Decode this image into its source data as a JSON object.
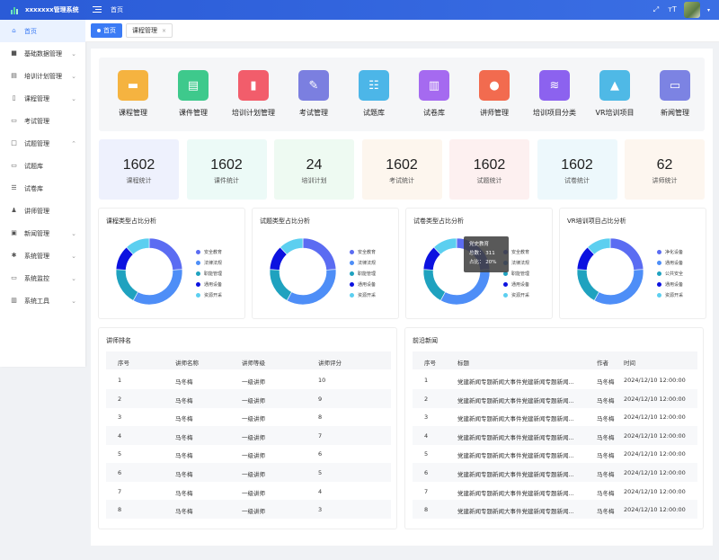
{
  "header": {
    "app_title": "xxxxxxx管理系统",
    "home_link": "首页"
  },
  "sidebar": {
    "items": [
      {
        "label": "首页",
        "icon": "home-icon",
        "glyph": "⌂",
        "active": true,
        "arrow": ""
      },
      {
        "label": "基础数据管理",
        "icon": "database-icon",
        "glyph": "■",
        "active": false,
        "arrow": "⌄"
      },
      {
        "label": "培训计划管理",
        "icon": "plan-icon",
        "glyph": "▤",
        "active": false,
        "arrow": "⌄"
      },
      {
        "label": "课程管理",
        "icon": "book-icon",
        "glyph": "▯",
        "active": false,
        "arrow": "⌄"
      },
      {
        "label": "考试管理",
        "icon": "exam-icon",
        "glyph": "▭",
        "active": false,
        "arrow": ""
      },
      {
        "label": "试题管理",
        "icon": "question-icon",
        "glyph": "□",
        "active": false,
        "arrow": "⌃"
      },
      {
        "label": "试题库",
        "icon": "bank-icon",
        "glyph": "▭",
        "active": false,
        "arrow": ""
      },
      {
        "label": "试卷库",
        "icon": "list-icon",
        "glyph": "☰",
        "active": false,
        "arrow": ""
      },
      {
        "label": "讲师管理",
        "icon": "teacher-icon",
        "glyph": "♟",
        "active": false,
        "arrow": ""
      },
      {
        "label": "新闻管理",
        "icon": "news-icon",
        "glyph": "▣",
        "active": false,
        "arrow": "⌄"
      },
      {
        "label": "系统管理",
        "icon": "gear-icon",
        "glyph": "✱",
        "active": false,
        "arrow": "⌄"
      },
      {
        "label": "系统监控",
        "icon": "monitor-icon",
        "glyph": "▭",
        "active": false,
        "arrow": "⌄"
      },
      {
        "label": "系统工具",
        "icon": "tools-icon",
        "glyph": "▥",
        "active": false,
        "arrow": "⌄"
      }
    ]
  },
  "tabs": [
    {
      "label": "首页",
      "active": true
    },
    {
      "label": "课程管理",
      "active": false
    }
  ],
  "modules": [
    {
      "label": "课程管理",
      "color": "#f5b340",
      "icon": "course-icon",
      "glyph": "▬"
    },
    {
      "label": "课件管理",
      "color": "#3ec98c",
      "icon": "courseware-icon",
      "glyph": "▤"
    },
    {
      "label": "培训计划管理",
      "color": "#f25d6b",
      "icon": "training-plan-icon",
      "glyph": "▮"
    },
    {
      "label": "考试管理",
      "color": "#7b7fe0",
      "icon": "exam-icon",
      "glyph": "✎"
    },
    {
      "label": "试题库",
      "color": "#4cb6e8",
      "icon": "question-bank-icon",
      "glyph": "☷"
    },
    {
      "label": "试卷库",
      "color": "#a56af0",
      "icon": "paper-bank-icon",
      "glyph": "▥"
    },
    {
      "label": "讲师管理",
      "color": "#f26b4f",
      "icon": "lecturer-icon",
      "glyph": "●"
    },
    {
      "label": "培训项目分类",
      "color": "#8c62ef",
      "icon": "layers-icon",
      "glyph": "≋"
    },
    {
      "label": "VR培训项目",
      "color": "#4fb9e6",
      "icon": "vr-icon",
      "glyph": "▲"
    },
    {
      "label": "新闻管理",
      "color": "#7c83e3",
      "icon": "message-icon",
      "glyph": "▭"
    }
  ],
  "stats": [
    {
      "value": "1602",
      "label": "课程统计",
      "bg": "#eef1fd"
    },
    {
      "value": "1602",
      "label": "课件统计",
      "bg": "#ecfaf7"
    },
    {
      "value": "24",
      "label": "培训计划",
      "bg": "#eefaf2"
    },
    {
      "value": "1602",
      "label": "考试统计",
      "bg": "#fdf6ee"
    },
    {
      "value": "1602",
      "label": "试题统计",
      "bg": "#fdf0f0"
    },
    {
      "value": "1602",
      "label": "试卷统计",
      "bg": "#edf8fc"
    },
    {
      "value": "62",
      "label": "讲师统计",
      "bg": "#fdf6ef"
    }
  ],
  "chart_data": [
    {
      "type": "pie",
      "title": "课程类型占比分析",
      "categories": [
        "安全教育",
        "法律法规",
        "职能管理",
        "通用设备",
        "资源开采"
      ],
      "values": [
        24,
        34,
        18,
        12,
        12
      ],
      "colors": [
        "#5b6cf2",
        "#4e8ef7",
        "#1fa2bf",
        "#0c12e0",
        "#5ccff0"
      ]
    },
    {
      "type": "pie",
      "title": "试题类型占比分析",
      "categories": [
        "安全教育",
        "法律法规",
        "职能管理",
        "通用设备",
        "资源开采"
      ],
      "values": [
        24,
        34,
        18,
        12,
        12
      ],
      "colors": [
        "#5b6cf2",
        "#4e8ef7",
        "#1fa2bf",
        "#0c12e0",
        "#5ccff0"
      ]
    },
    {
      "type": "pie",
      "title": "试卷类型占比分析",
      "categories": [
        "安全教育",
        "法律法规",
        "职能管理",
        "通用设备",
        "资源开采"
      ],
      "values": [
        24,
        34,
        18,
        12,
        12
      ],
      "colors": [
        "#5b6cf2",
        "#4e8ef7",
        "#1fa2bf",
        "#0c12e0",
        "#5ccff0"
      ],
      "tooltip": {
        "name": "党史教育",
        "count_label": "总数：",
        "count": "311",
        "ratio_label": "占比：",
        "ratio": "20%"
      }
    },
    {
      "type": "pie",
      "title": "VR培训项目占比分析",
      "categories": [
        "净化设备",
        "通用设备",
        "公共安全",
        "通用设备",
        "资源开采"
      ],
      "values": [
        24,
        34,
        18,
        12,
        12
      ],
      "colors": [
        "#5b6cf2",
        "#4e8ef7",
        "#1fa2bf",
        "#0c12e0",
        "#5ccff0"
      ]
    }
  ],
  "lecturer_table": {
    "title": "讲师排名",
    "columns": [
      "序号",
      "讲师名称",
      "讲师等级",
      "讲师评分"
    ],
    "rows": [
      [
        "1",
        "马冬梅",
        "一级讲师",
        "10"
      ],
      [
        "2",
        "马冬梅",
        "一级讲师",
        "9"
      ],
      [
        "3",
        "马冬梅",
        "一级讲师",
        "8"
      ],
      [
        "4",
        "马冬梅",
        "一级讲师",
        "7"
      ],
      [
        "5",
        "马冬梅",
        "一级讲师",
        "6"
      ],
      [
        "6",
        "马冬梅",
        "一级讲师",
        "5"
      ],
      [
        "7",
        "马冬梅",
        "一级讲师",
        "4"
      ],
      [
        "8",
        "马冬梅",
        "一级讲师",
        "3"
      ]
    ]
  },
  "news_table": {
    "title": "前沿新闻",
    "columns": [
      "序号",
      "标题",
      "作者",
      "时间"
    ],
    "rows": [
      [
        "1",
        "党建新闻专题新闻大事件党建新闻专题新闻...",
        "马冬梅",
        "2024/12/10 12:00:00"
      ],
      [
        "2",
        "党建新闻专题新闻大事件党建新闻专题新闻...",
        "马冬梅",
        "2024/12/10 12:00:00"
      ],
      [
        "3",
        "党建新闻专题新闻大事件党建新闻专题新闻...",
        "马冬梅",
        "2024/12/10 12:00:00"
      ],
      [
        "4",
        "党建新闻专题新闻大事件党建新闻专题新闻...",
        "马冬梅",
        "2024/12/10 12:00:00"
      ],
      [
        "5",
        "党建新闻专题新闻大事件党建新闻专题新闻...",
        "马冬梅",
        "2024/12/10 12:00:00"
      ],
      [
        "6",
        "党建新闻专题新闻大事件党建新闻专题新闻...",
        "马冬梅",
        "2024/12/10 12:00:00"
      ],
      [
        "7",
        "党建新闻专题新闻大事件党建新闻专题新闻...",
        "马冬梅",
        "2024/12/10 12:00:00"
      ],
      [
        "8",
        "党建新闻专题新闻大事件党建新闻专题新闻...",
        "马冬梅",
        "2024/12/10 12:00:00"
      ]
    ]
  }
}
